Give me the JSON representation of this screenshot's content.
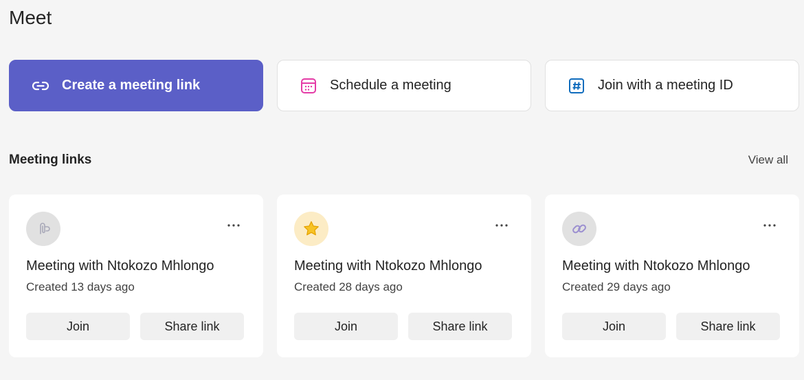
{
  "page": {
    "title": "Meet"
  },
  "actions": {
    "create": {
      "label": "Create a meeting link",
      "icon": "link-icon"
    },
    "schedule": {
      "label": "Schedule a meeting",
      "icon": "calendar-icon"
    },
    "join_id": {
      "label": "Join with a meeting ID",
      "icon": "hashtag-icon"
    }
  },
  "section": {
    "title": "Meeting links",
    "view_all": "View all"
  },
  "cards": [
    {
      "name": "Meeting with Ntokozo Mhlongo",
      "created": "Created 13 days ago",
      "icon": "paperclip-icon",
      "join": "Join",
      "share": "Share link"
    },
    {
      "name": "Meeting with Ntokozo Mhlongo",
      "created": "Created 28 days ago",
      "icon": "star-icon",
      "join": "Join",
      "share": "Share link"
    },
    {
      "name": "Meeting with Ntokozo Mhlongo",
      "created": "Created 29 days ago",
      "icon": "chain-link-icon",
      "join": "Join",
      "share": "Share link"
    }
  ],
  "colors": {
    "primary": "#5b5fc7",
    "calendar_accent": "#e43ba6",
    "hashtag_accent": "#0f6cbd",
    "background": "#f5f5f5"
  }
}
